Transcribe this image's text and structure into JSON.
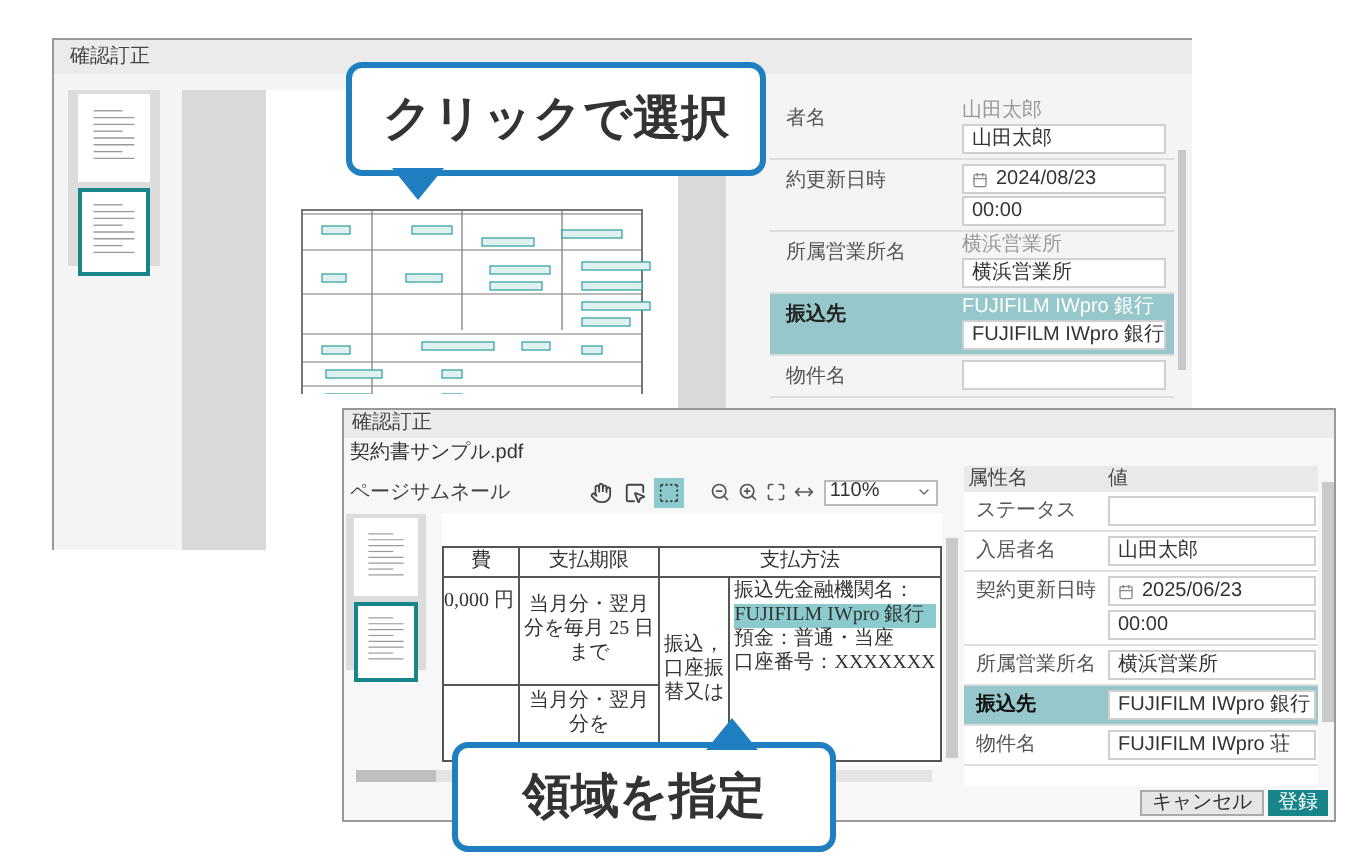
{
  "back_window": {
    "title": "確認訂正",
    "thumbnails": [
      {
        "selected": false
      },
      {
        "selected": true
      }
    ],
    "properties": [
      {
        "label": "者名",
        "hint": "山田太郎",
        "fields": [
          {
            "kind": "text",
            "value": "山田太郎"
          }
        ],
        "selected": false
      },
      {
        "label": "約更新日時",
        "fields": [
          {
            "kind": "date",
            "value": "2024/08/23"
          },
          {
            "kind": "text",
            "value": "00:00"
          }
        ],
        "selected": false
      },
      {
        "label": "所属営業所名",
        "hint": "横浜営業所",
        "fields": [
          {
            "kind": "text",
            "value": "横浜営業所"
          }
        ],
        "selected": false
      },
      {
        "label": "振込先",
        "hint": "FUJIFILM IWpro 銀行",
        "fields": [
          {
            "kind": "text",
            "value": "FUJIFILM IWpro 銀行"
          }
        ],
        "selected": true
      },
      {
        "label": "物件名",
        "fields": [
          {
            "kind": "text"
          }
        ],
        "selected": false
      }
    ]
  },
  "front_window": {
    "title": "確認訂正",
    "file_name": "契約書サンプル.pdf",
    "thumbnail_label": "ページサムネール",
    "thumbnails": [
      {
        "selected": false
      },
      {
        "selected": true
      }
    ],
    "tools": [
      {
        "kind": "hand",
        "selected": false
      },
      {
        "kind": "select",
        "selected": false
      },
      {
        "kind": "region",
        "selected": true
      }
    ],
    "view_tools": [
      {
        "kind": "zoom-out"
      },
      {
        "kind": "zoom-in"
      },
      {
        "kind": "fit"
      },
      {
        "kind": "width"
      }
    ],
    "zoom": "110%",
    "document": {
      "headers": [
        "費",
        "支払期限",
        "支払方法"
      ],
      "amount": "0,000 円",
      "deadlines": [
        "当月分・翌月分を毎月 25 日まで",
        "当月分・翌月分を"
      ],
      "method": "振込，口座振替又は",
      "details": [
        {
          "text": "振込先金融機関名：",
          "highlighted": false
        },
        {
          "text": "FUJIFILM IWpro 銀行",
          "highlighted": true
        },
        {
          "text": "預金：普通・当座",
          "highlighted": false
        },
        {
          "text": "口座番号：XXXXXXX",
          "highlighted": false
        }
      ]
    },
    "grid": {
      "columns": [
        "属性名",
        "値"
      ],
      "rows": [
        {
          "label": "ステータス",
          "fields": [
            {
              "kind": "text"
            }
          ],
          "selected": false
        },
        {
          "label": "入居者名",
          "fields": [
            {
              "kind": "text",
              "value": "山田太郎"
            }
          ],
          "selected": false
        },
        {
          "label": "契約更新日時",
          "fields": [
            {
              "kind": "date",
              "value": "2025/06/23"
            },
            {
              "kind": "text",
              "value": "00:00"
            }
          ],
          "selected": false
        },
        {
          "label": "所属営業所名",
          "fields": [
            {
              "kind": "text",
              "value": "横浜営業所"
            }
          ],
          "selected": false
        },
        {
          "label": "振込先",
          "fields": [
            {
              "kind": "text",
              "value": "FUJIFILM IWpro 銀行"
            }
          ],
          "selected": true
        },
        {
          "label": "物件名",
          "fields": [
            {
              "kind": "text",
              "value": "FUJIFILM IWpro 荘"
            }
          ],
          "selected": false
        }
      ]
    },
    "buttons": [
      {
        "label": "キャンセル",
        "kind": "secondary"
      },
      {
        "label": "登録",
        "kind": "primary"
      }
    ]
  },
  "callouts": [
    {
      "text": "クリックで選択",
      "pointer_below": true
    },
    {
      "text": "領域を指定",
      "pointer_below": false
    }
  ]
}
